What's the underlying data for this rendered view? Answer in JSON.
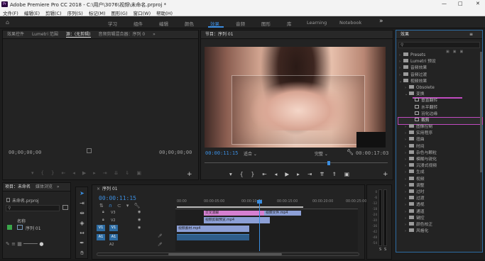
{
  "app": {
    "title": "Adobe Premiere Pro CC 2018 - C:\\用户\\3076\\视频\\未命名.prproj *",
    "icon": "Pr"
  },
  "window_controls": [
    "—",
    "□",
    "✕"
  ],
  "menu": [
    "文件(F)",
    "编辑(E)",
    "剪辑(C)",
    "序列(S)",
    "标记(M)",
    "图形(G)",
    "窗口(W)",
    "帮助(H)"
  ],
  "workspaces": [
    "学习",
    "组件",
    "编辑",
    "颜色",
    "效果",
    "音频",
    "图形",
    "库",
    "Learning",
    "Notebook"
  ],
  "workspaces_more": "»",
  "source_panel": {
    "tabs": [
      "效果控件",
      "Lumetri 范围",
      "源：(无剪辑)",
      "音频剪辑混合器：序列 0"
    ],
    "more": "»",
    "tc_left": "00;00;00;00",
    "tc_right": "00;00;00;00"
  },
  "program": {
    "tab": "节目：序列 01",
    "tc_current": "00:00:11:15",
    "fit": "适合",
    "quality": "完整",
    "tc_duration": "00:00:17:03"
  },
  "project": {
    "tabs": [
      "项目：未命名",
      "媒体浏览"
    ],
    "more": "»",
    "file": "未命名.prproj",
    "col_name": "名称",
    "item": "序列 01"
  },
  "timeline": {
    "tab": "序列 01",
    "tc": "00:00:11:15",
    "ruler": [
      "00:00",
      "00:00:05:00",
      "00:00:10:00",
      "00:00:15:00",
      "00:00:20:00",
      "00:00:25:00"
    ],
    "tracks": [
      {
        "name": "V3"
      },
      {
        "name": "V2"
      },
      {
        "name": "V1",
        "source": "V1"
      },
      {
        "name": "A1",
        "source": "A1"
      },
      {
        "name": "A2"
      }
    ],
    "clips": [
      "交叉溶解",
      "视频文件.mp4",
      "视频剪辑预览.mp4",
      "交叉溶解",
      "视频素材.mp4"
    ],
    "meter_labels": [
      "0",
      "-6",
      "-12",
      "-18",
      "-24",
      "-30",
      "-36",
      "-42",
      "-48",
      "-54"
    ],
    "meter_bottom": [
      "S",
      "S"
    ]
  },
  "effects": {
    "title": "效果",
    "more": "≡",
    "tree": [
      {
        "label": "Presets",
        "level": 0,
        "arrow": "›"
      },
      {
        "label": "Lumetri 预设",
        "level": 0,
        "arrow": "›"
      },
      {
        "label": "音频效果",
        "level": 0,
        "arrow": "›"
      },
      {
        "label": "音频过渡",
        "level": 0,
        "arrow": "›"
      },
      {
        "label": "视频效果",
        "level": 0,
        "arrow": "⌄"
      },
      {
        "label": "Obsolete",
        "level": 1,
        "arrow": "›"
      },
      {
        "label": "变换",
        "level": 1,
        "arrow": "⌄",
        "underline": true
      },
      {
        "label": "垂直翻转",
        "level": 2,
        "arrow": ""
      },
      {
        "label": "水平翻转",
        "level": 2,
        "arrow": ""
      },
      {
        "label": "羽化边缘",
        "level": 2,
        "arrow": ""
      },
      {
        "label": "裁剪",
        "level": 2,
        "arrow": "",
        "selected": true
      },
      {
        "label": "图像控制",
        "level": 1,
        "arrow": "›"
      },
      {
        "label": "实用程序",
        "level": 1,
        "arrow": "›"
      },
      {
        "label": "扭曲",
        "level": 1,
        "arrow": "›"
      },
      {
        "label": "时间",
        "level": 1,
        "arrow": "›"
      },
      {
        "label": "杂色与颗粒",
        "level": 1,
        "arrow": "›"
      },
      {
        "label": "模糊与锐化",
        "level": 1,
        "arrow": "›"
      },
      {
        "label": "沉浸式视频",
        "level": 1,
        "arrow": "›"
      },
      {
        "label": "生成",
        "level": 1,
        "arrow": "›"
      },
      {
        "label": "视频",
        "level": 1,
        "arrow": "›"
      },
      {
        "label": "调整",
        "level": 1,
        "arrow": "›"
      },
      {
        "label": "过时",
        "level": 1,
        "arrow": "›"
      },
      {
        "label": "过渡",
        "level": 1,
        "arrow": "›"
      },
      {
        "label": "透视",
        "level": 1,
        "arrow": "›"
      },
      {
        "label": "通道",
        "level": 1,
        "arrow": "›"
      },
      {
        "label": "键控",
        "level": 1,
        "arrow": "›"
      },
      {
        "label": "颜色校正",
        "level": 1,
        "arrow": "›"
      },
      {
        "label": "风格化",
        "level": 1,
        "arrow": "›"
      }
    ]
  },
  "colors": {
    "accent": "#3b8ee0",
    "workspace_active": "#3c8de0",
    "clip_pink": "#d57fd0",
    "clip_blue": "#8c9fd6",
    "selected_outline": "#c04ac0",
    "audio_clip": "#2e5d8a"
  }
}
